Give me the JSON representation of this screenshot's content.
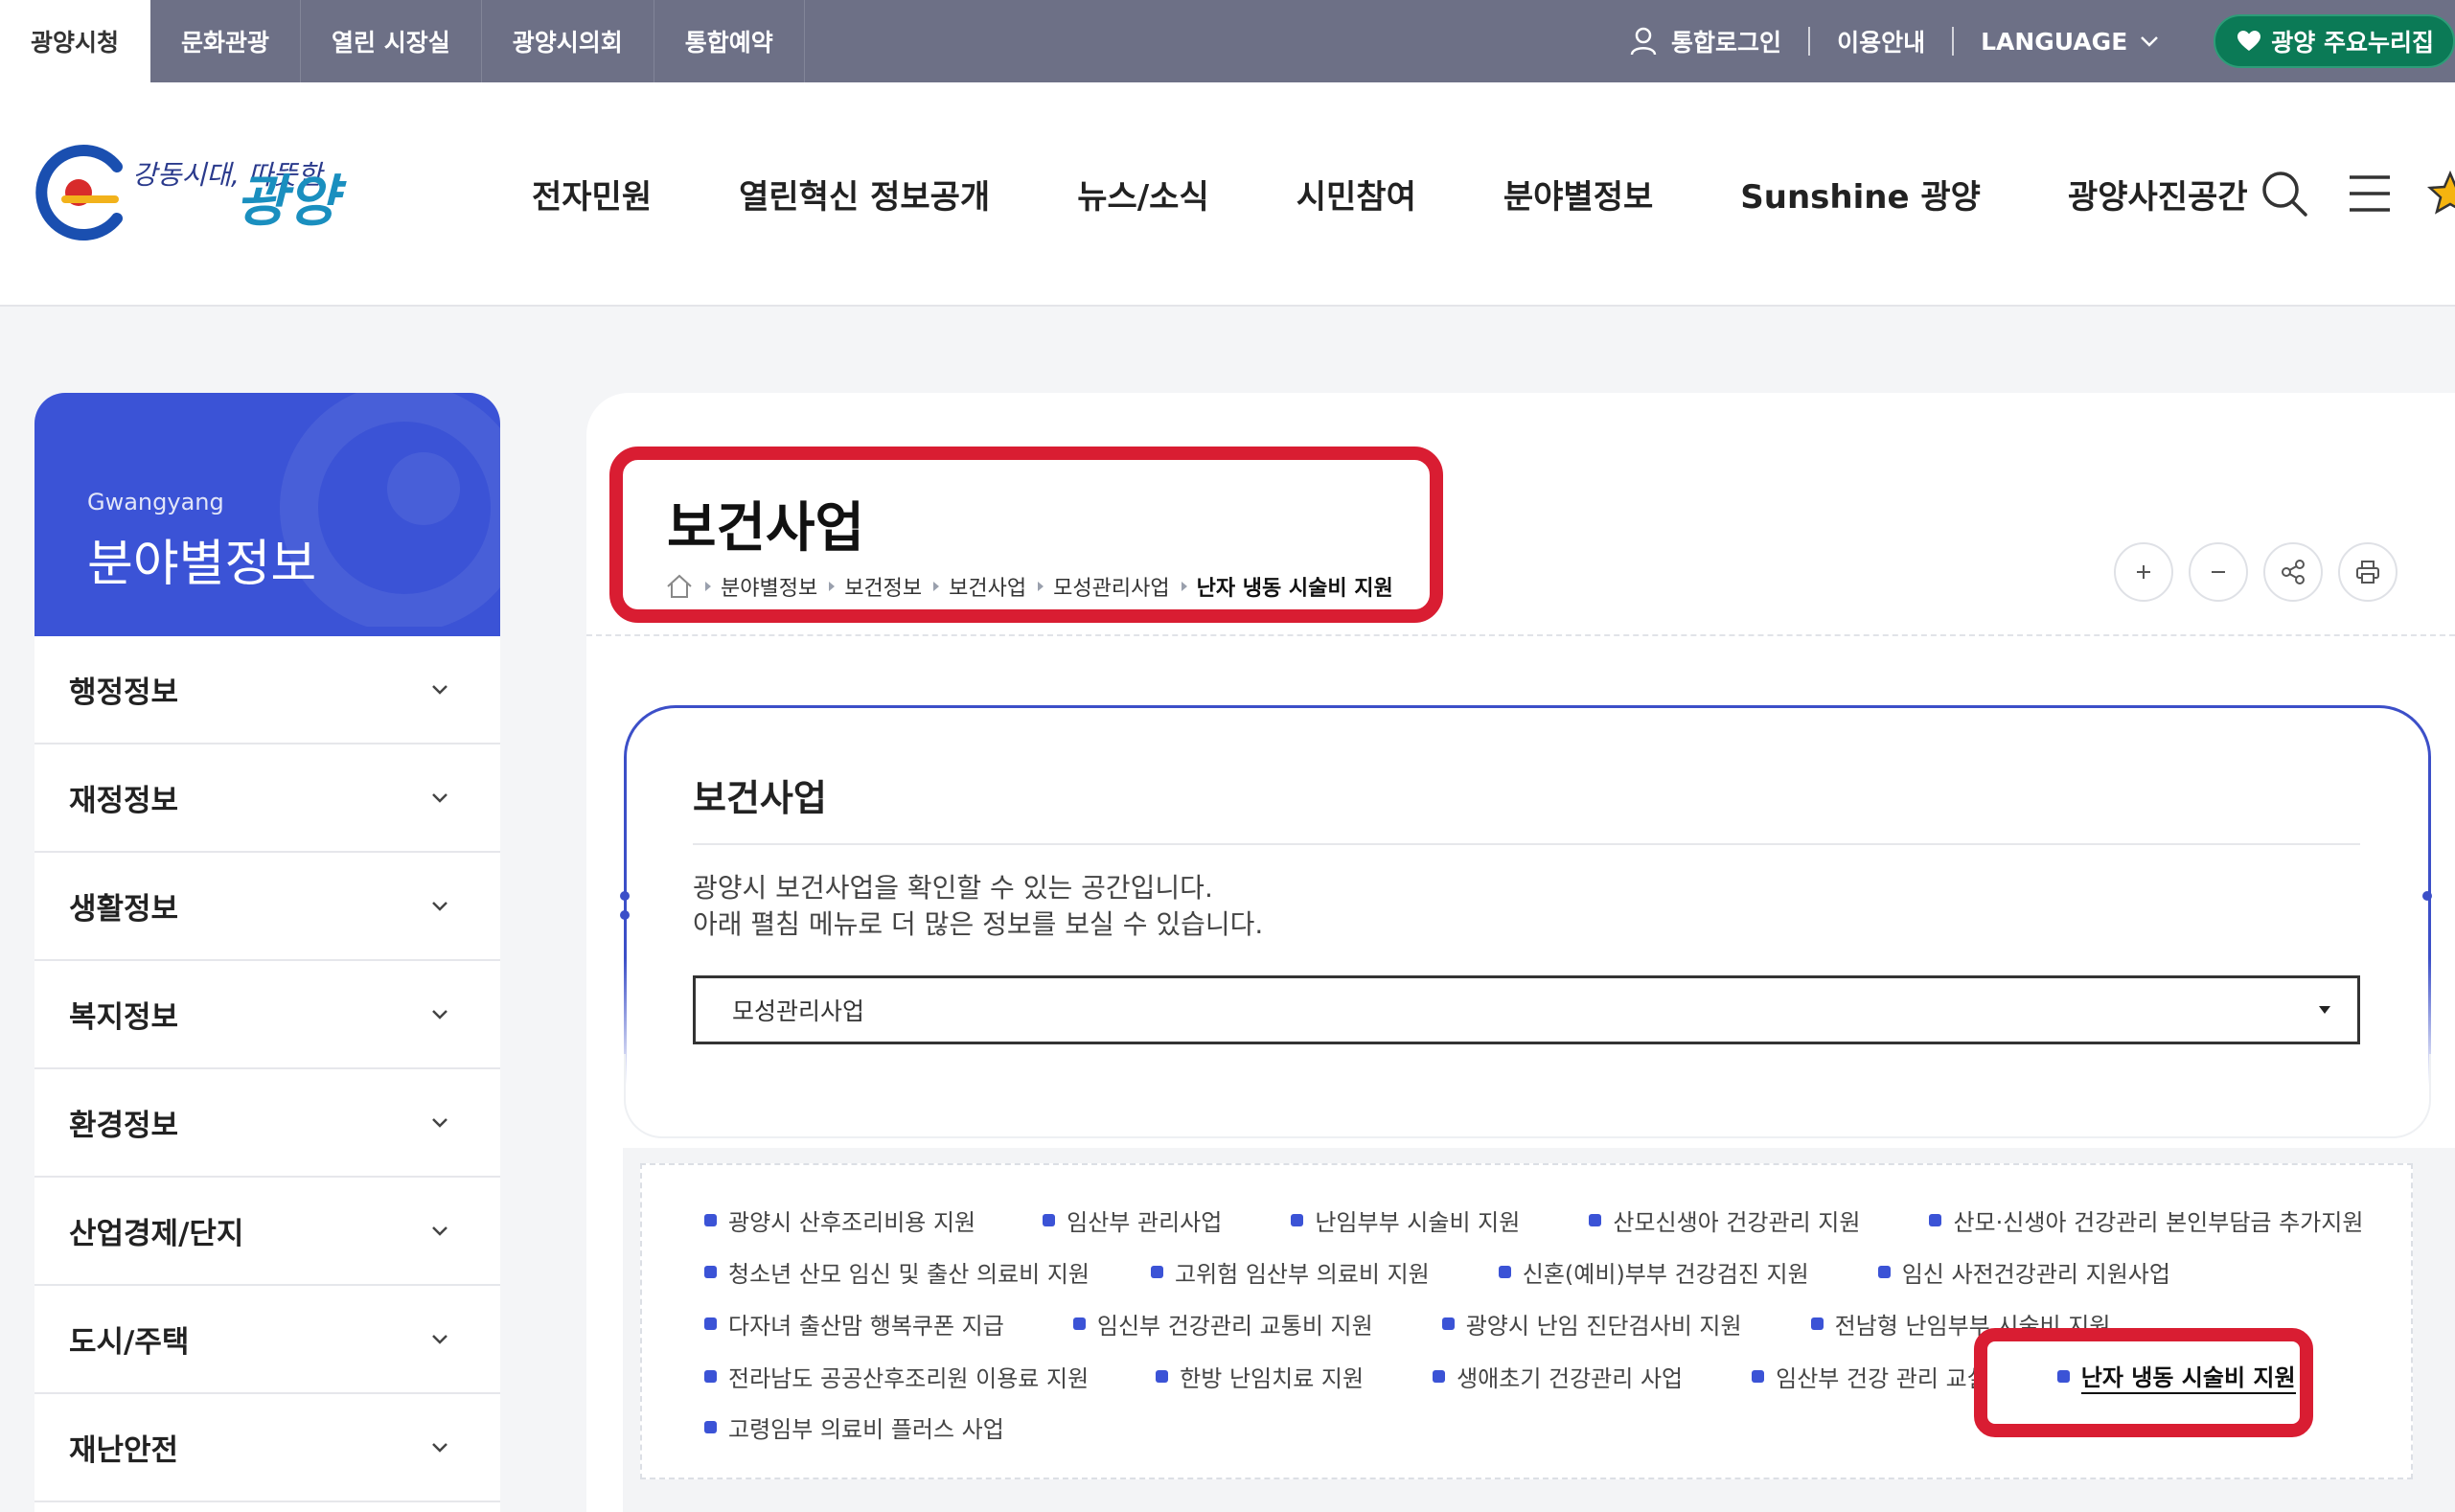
{
  "utility_bar": {
    "tabs": [
      "광양시청",
      "문화관광",
      "열린 시장실",
      "광양시의회",
      "통합예약"
    ],
    "login": "통합로그인",
    "guide": "이용안내",
    "language": "LANGUAGE",
    "featured_button": "광양 주요누리집"
  },
  "header": {
    "logo_text": "광양",
    "logo_slogan": "강동시대, 따뜻한",
    "nav": [
      "전자민원",
      "열린혁신 정보공개",
      "뉴스/소식",
      "시민참여",
      "분야별정보",
      "Sunshine 광양",
      "광양사진공간"
    ]
  },
  "sidebar": {
    "subtitle": "Gwangyang",
    "title": "분야별정보",
    "items": [
      "행정정보",
      "재정정보",
      "생활정보",
      "복지정보",
      "환경정보",
      "산업경제/단지",
      "도시/주택",
      "재난안전"
    ]
  },
  "page": {
    "title": "보건사업",
    "breadcrumb": [
      "분야별정보",
      "보건정보",
      "보건사업",
      "모성관리사업",
      "난자 냉동 시술비 지원"
    ]
  },
  "intro": {
    "title": "보건사업",
    "desc_line1": "광양시 보건사업을 확인할 수 있는 공간입니다.",
    "desc_line2": "아래 펼침 메뉴로 더 많은 정보를 보실 수 있습니다.",
    "select_value": "모성관리사업"
  },
  "links": [
    [
      "광양시 산후조리비용 지원",
      "임산부 관리사업",
      "난임부부 시술비 지원",
      "산모신생아 건강관리 지원",
      "산모·신생아 건강관리 본인부담금 추가지원"
    ],
    [
      "청소년 산모 임신 및 출산 의료비 지원",
      "고위험 임산부 의료비 지원",
      "신혼(예비)부부 건강검진 지원",
      "임신 사전건강관리 지원사업"
    ],
    [
      "다자녀 출산맘 행복쿠폰 지급",
      "임신부 건강관리 교통비 지원",
      "광양시 난임 진단검사비 지원",
      "전남형 난임부부 시술비 지원"
    ],
    [
      "전라남도 공공산후조리원 이용료 지원",
      "한방 난임치료 지원",
      "생애초기 건강관리 사업",
      "임산부 건강 관리 교실",
      "난자 냉동 시술비 지원"
    ],
    [
      "고령임부 의료비 플러스 사업"
    ]
  ],
  "active_link": "난자 냉동 시술비 지원",
  "colors": {
    "utility_bg": "#6d7086",
    "primary_blue": "#3b53d6",
    "highlight_red": "#d91d32",
    "cta_green": "#0b7a56"
  },
  "icons": [
    "user-icon",
    "chevron-down-icon",
    "heart-icon",
    "search-icon",
    "menu-icon",
    "star-icon",
    "home-icon",
    "zoom-in-icon",
    "zoom-out-icon",
    "share-icon",
    "print-icon"
  ]
}
